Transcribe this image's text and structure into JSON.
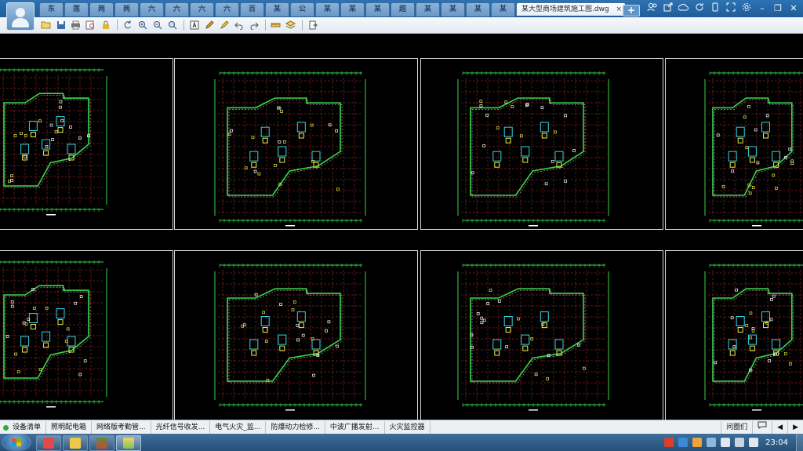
{
  "title_bar": {
    "tabs": [
      "东",
      "莲",
      "两",
      "两",
      "六",
      "六",
      "六",
      "六",
      "百",
      "某",
      "公",
      "某",
      "某",
      "某",
      "超",
      "某",
      "某",
      "某",
      "某"
    ],
    "active_tab": {
      "label": "某大型商场建筑施工图.dwg",
      "close": "×"
    },
    "new_tab": "+",
    "window_controls": {
      "minimize": "–",
      "restore": "❐",
      "close": "✕"
    }
  },
  "toolbar": {
    "icons": [
      "open-icon",
      "save-icon",
      "print-icon",
      "print-preview-icon",
      "lock-icon",
      "rotate-icon",
      "zoom-in-icon",
      "zoom-out-icon",
      "zoom-extents-icon",
      "text-icon",
      "pencil-icon",
      "highlighter-icon",
      "undo-icon",
      "redo-icon",
      "measure-icon",
      "layers-icon",
      "export-icon"
    ]
  },
  "layout_tabs": {
    "items": [
      "设备清单",
      "照明配电箱",
      "网络版考勤管...",
      "光纤信号收发...",
      "电气火灾_监...",
      "防爆动力检修...",
      "中波广播发射...",
      "火灾监控器"
    ],
    "right": {
      "label": "问圈们",
      "chat_icon": "chat-icon",
      "arrows": [
        "◀",
        "▶"
      ]
    }
  },
  "taskbar": {
    "apps": [
      "media-player",
      "explorer",
      "library",
      "paint"
    ],
    "clock": "23:04"
  },
  "colors": {
    "tabbar": "#1f5d99",
    "frame": "#d8d8d8",
    "wall_green": "#39d64a",
    "grid_red": "#b03030",
    "accent_cyan": "#2fd6e0",
    "accent_yellow": "#e6f04a"
  },
  "drawing_sheets": [
    {
      "name": "sheet-1"
    },
    {
      "name": "sheet-2"
    },
    {
      "name": "sheet-3"
    },
    {
      "name": "sheet-4"
    },
    {
      "name": "sheet-5"
    },
    {
      "name": "sheet-6"
    },
    {
      "name": "sheet-7"
    },
    {
      "name": "sheet-8"
    }
  ]
}
